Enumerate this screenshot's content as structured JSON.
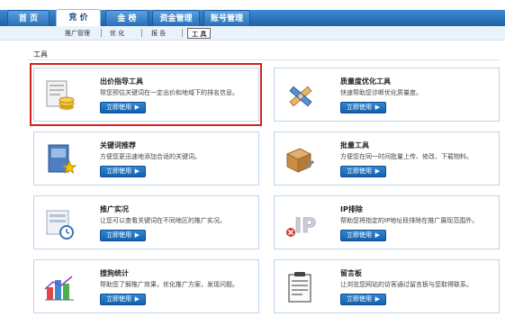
{
  "topnav": {
    "tabs": [
      {
        "label": "首 页"
      },
      {
        "label": "竞 价"
      },
      {
        "label": "金 榜"
      },
      {
        "label": "资金管理"
      },
      {
        "label": "账号管理"
      }
    ]
  },
  "subnav": {
    "items": [
      {
        "label": "推广管理"
      },
      {
        "label": "优 化"
      },
      {
        "label": "报 告"
      },
      {
        "label": "工 具"
      }
    ]
  },
  "section": {
    "title": "工具"
  },
  "cards": [
    {
      "title": "出价指导工具",
      "desc": "帮您预估关键词在一定出价和地域下的排名信息。",
      "button": "立即使用",
      "icon": "bid-guide-icon"
    },
    {
      "title": "质量度优化工具",
      "desc": "快速帮助您诊断优化质量度。",
      "button": "立即使用",
      "icon": "quality-tools-icon"
    },
    {
      "title": "关键词推荐",
      "desc": "方便您更迅速地添加合适的关键词。",
      "button": "立即使用",
      "icon": "keyword-book-icon"
    },
    {
      "title": "批量工具",
      "desc": "方便您在同一时间批量上传、修改、下载物料。",
      "button": "立即使用",
      "icon": "batch-box-icon"
    },
    {
      "title": "推广实况",
      "desc": "让您可以查看关键词在不同地区的推广实况。",
      "button": "立即使用",
      "icon": "live-promo-icon"
    },
    {
      "title": "IP排除",
      "desc": "帮助您将指定的IP地址段排除在推广展现范围外。",
      "button": "立即使用",
      "icon": "ip-exclude-icon"
    },
    {
      "title": "搜狗统计",
      "desc": "帮助您了解推广效果，优化推广方案，发现问题。",
      "button": "立即使用",
      "icon": "stats-chart-icon"
    },
    {
      "title": "留言板",
      "desc": "让浏览您网站的访客通过留言板与您取得联系。",
      "button": "立即使用",
      "icon": "message-board-icon"
    }
  ],
  "colors": {
    "brand_blue": "#2a6fb8",
    "highlight_red": "#d62020",
    "card_border": "#bfd6ec"
  }
}
